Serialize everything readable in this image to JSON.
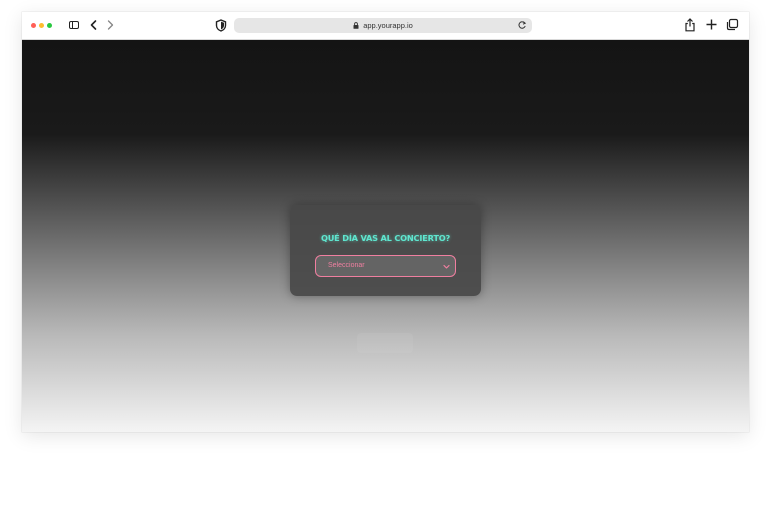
{
  "browser": {
    "url": "app.yourapp.io",
    "icons": {
      "sidebar": "sidebar-icon",
      "back": "chevron-left-icon",
      "forward": "chevron-right-icon",
      "privacy": "shield-icon",
      "lock": "lock-icon",
      "reload": "reload-icon",
      "share": "share-icon",
      "new_tab": "plus-icon",
      "tabs": "tabs-overview-icon"
    }
  },
  "page": {
    "question": "QUÉ DÍA VAS AL CONCIERTO?",
    "select": {
      "selected": "Seleccionar"
    }
  },
  "colors": {
    "accent_cyan": "#5fe6cf",
    "accent_pink": "#f07fa0",
    "card_bg": "#484848"
  }
}
